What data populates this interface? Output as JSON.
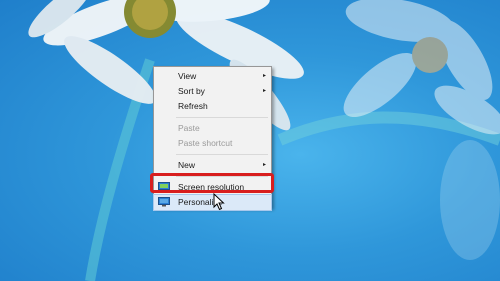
{
  "context_menu": {
    "items": [
      {
        "label": "View",
        "submenu_arrow": "▸"
      },
      {
        "label": "Sort by",
        "submenu_arrow": "▸"
      },
      {
        "label": "Refresh"
      },
      {
        "label": "Paste",
        "disabled": true
      },
      {
        "label": "Paste shortcut",
        "disabled": true
      },
      {
        "label": "New",
        "submenu_arrow": "▸"
      },
      {
        "label": "Screen resolution",
        "icon": "monitor-icon",
        "highlighted_by_annotation": true
      },
      {
        "label": "Personalize",
        "icon": "monitor-icon",
        "hovered": true
      }
    ]
  },
  "colors": {
    "desktop_blue": "#2f97da",
    "menu_background": "#f2f2f2",
    "annotation_red": "#d81e1e",
    "hover_blue": "#dbe9f8"
  }
}
